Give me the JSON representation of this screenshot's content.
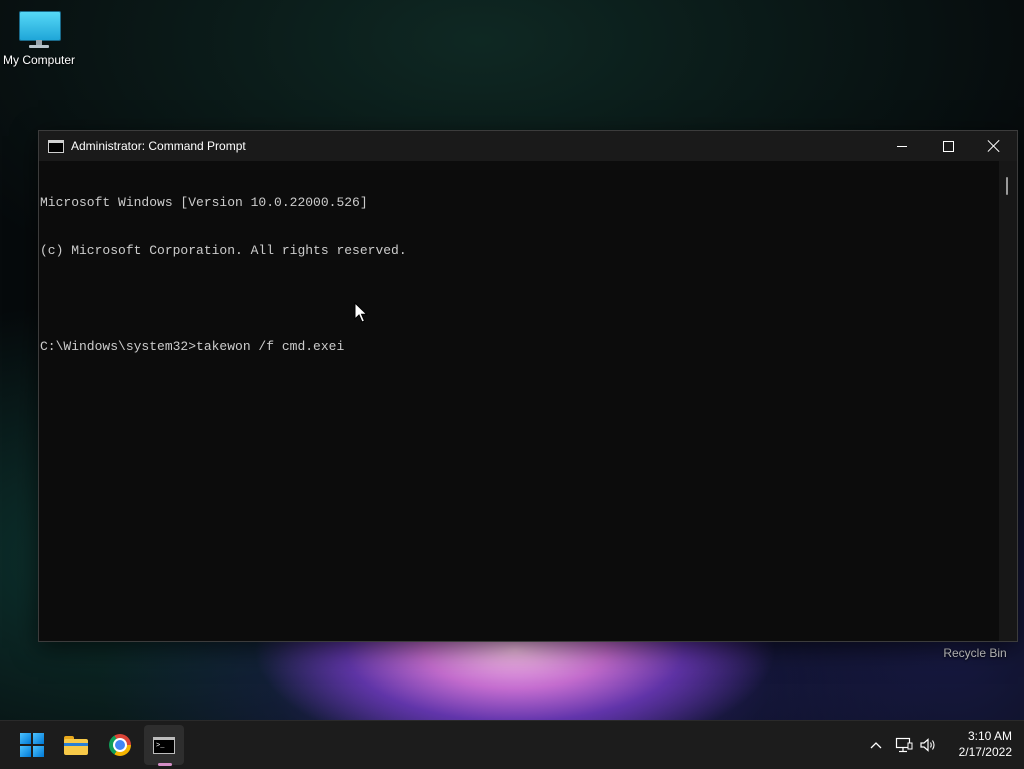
{
  "desktop": {
    "icons": [
      {
        "label": "My Computer",
        "icon": "monitor-icon"
      },
      {
        "label": "Recycle Bin",
        "icon": "recycle-bin-icon"
      }
    ]
  },
  "window": {
    "title": "Administrator: Command Prompt",
    "icon": "console-icon",
    "controls": {
      "minimize": "minimize-icon",
      "maximize": "maximize-icon",
      "close": "close-icon"
    }
  },
  "console": {
    "lines": [
      "Microsoft Windows [Version 10.0.22000.526]",
      "(c) Microsoft Corporation. All rights reserved.",
      "",
      "C:\\Windows\\system32>takewon /f cmd.exei"
    ]
  },
  "taskbar": {
    "apps": [
      {
        "name": "Start",
        "icon": "windows-start-icon",
        "active": false
      },
      {
        "name": "File Explorer",
        "icon": "folder-icon",
        "active": false
      },
      {
        "name": "Google Chrome",
        "icon": "chrome-icon",
        "active": false
      },
      {
        "name": "Command Prompt",
        "icon": "cmd-icon",
        "active": true
      }
    ],
    "tray": {
      "icons": [
        "chevron-up-icon",
        "network-icon",
        "volume-icon"
      ],
      "time": "3:10 AM",
      "date": "2/17/2022"
    }
  }
}
